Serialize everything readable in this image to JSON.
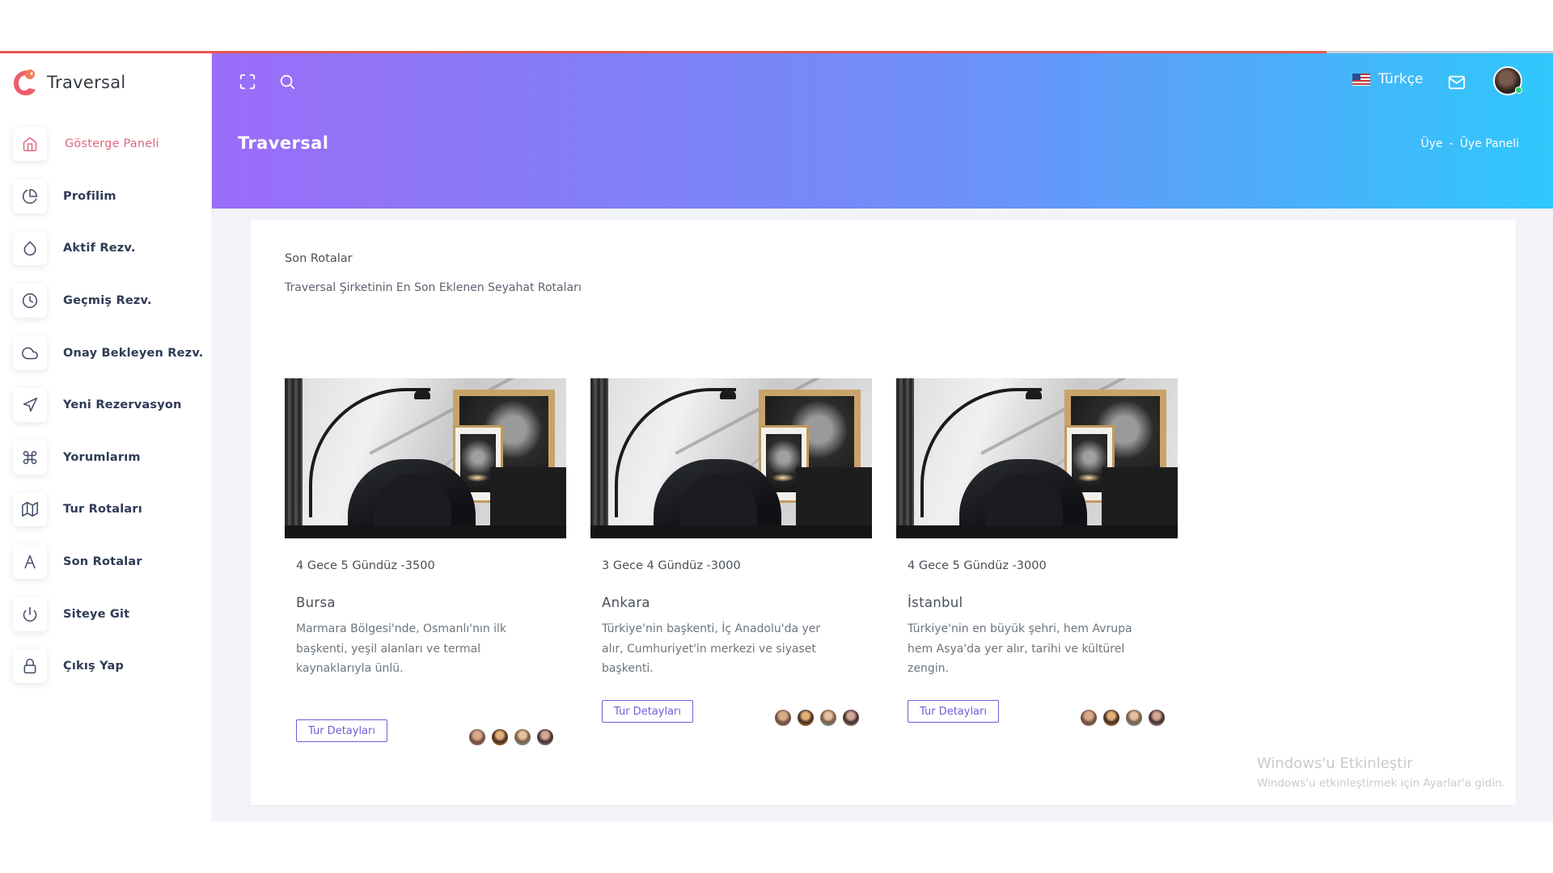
{
  "app": {
    "brand_name": "Traversal"
  },
  "sidebar": {
    "items": [
      {
        "label": "Gösterge Paneli",
        "icon": "home-icon",
        "active": true
      },
      {
        "label": "Profilim",
        "icon": "pie-chart-icon"
      },
      {
        "label": "Aktif Rezv.",
        "icon": "droplet-icon"
      },
      {
        "label": "Geçmiş Rezv.",
        "icon": "clock-icon"
      },
      {
        "label": "Onay Bekleyen Rezv.",
        "icon": "cloud-icon"
      },
      {
        "label": "Yeni Rezervasyon",
        "icon": "navigation-icon"
      },
      {
        "label": "Yorumlarım",
        "icon": "command-icon"
      },
      {
        "label": "Tur Rotaları",
        "icon": "map-icon"
      },
      {
        "label": "Son Rotalar",
        "icon": "letter-a-icon"
      },
      {
        "label": "Siteye Git",
        "icon": "power-icon"
      },
      {
        "label": "Çıkış Yap",
        "icon": "lock-icon"
      }
    ]
  },
  "header": {
    "language": "Türkçe",
    "page_title": "Traversal",
    "breadcrumb": [
      "Üye",
      "-",
      "Üye Paneli"
    ]
  },
  "card": {
    "title": "Son Rotalar",
    "subtitle": "Traversal Şirketinin En Son Eklenen Seyahat Rotaları",
    "tours": [
      {
        "meta": "4 Gece 5 Gündüz -3500",
        "name": "Bursa",
        "description": "Marmara Bölgesi'nde, Osmanlı'nın ilk başkenti, yeşil alanları ve termal kaynaklarıyla ünlü.",
        "button": "Tur Detayları"
      },
      {
        "meta": "3 Gece 4 Gündüz -3000",
        "name": "Ankara",
        "description": "Türkiye'nin başkenti, İç Anadolu'da yer alır, Cumhuriyet'in merkezi ve siyaset başkenti.",
        "button": "Tur Detayları"
      },
      {
        "meta": "4 Gece 5 Gündüz -3000",
        "name": "İstanbul",
        "description": "Türkiye'nin en büyük şehri, hem Avrupa hem Asya'da yer alır, tarihi ve kültürel zengin.",
        "button": "Tur Detayları"
      }
    ]
  },
  "watermark": {
    "title": "Windows'u Etkinleştir",
    "subtitle": "Windows'u etkinleştirmek için Ayarlar'a gidin."
  },
  "colors": {
    "accent": "#e0667f",
    "gradient_start": "#9b6cf8",
    "gradient_end": "#2fc8fb",
    "button": "#6d5fd9"
  }
}
